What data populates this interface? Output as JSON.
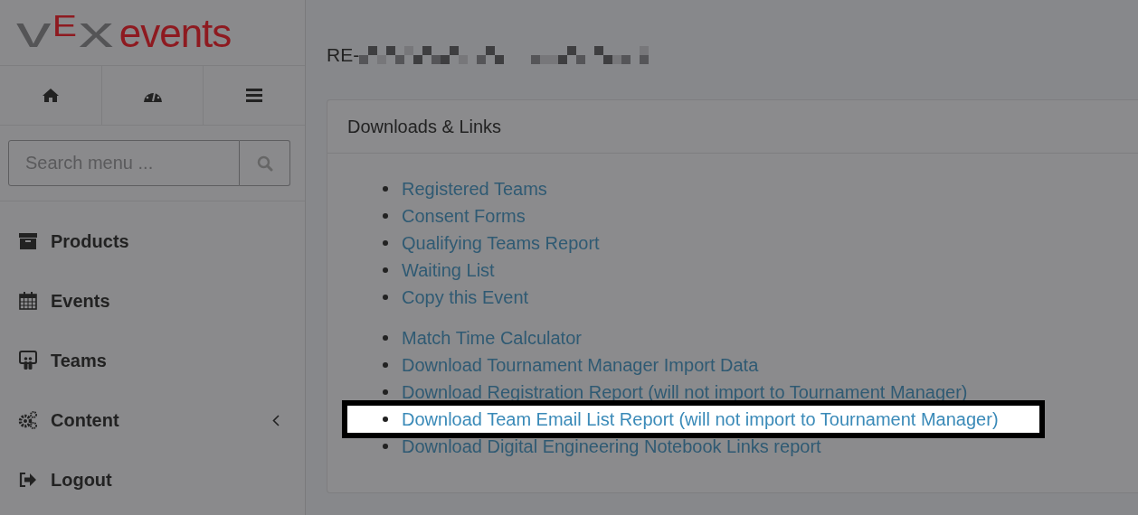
{
  "logo": {
    "mark": [
      {
        "text": "v",
        "kind": "plain"
      },
      {
        "text": "E",
        "kind": "accent"
      },
      {
        "text": "x",
        "kind": "plain"
      }
    ],
    "name": "events"
  },
  "toolbar": [
    {
      "kind": "home"
    },
    {
      "kind": "dashboard"
    },
    {
      "kind": "menu"
    }
  ],
  "search": {
    "placeholder": "Search menu ..."
  },
  "nav": [
    {
      "label": "Products",
      "kind": "box",
      "has_submenu": false
    },
    {
      "label": "Events",
      "kind": "calendar",
      "has_submenu": false
    },
    {
      "label": "Teams",
      "kind": "team",
      "has_submenu": false
    },
    {
      "label": "Content",
      "kind": "gears",
      "has_submenu": true
    },
    {
      "label": "Logout",
      "kind": "logout",
      "has_submenu": false
    }
  ],
  "page_title": "RE-",
  "card": {
    "title": "Downloads & Links",
    "groups": [
      {
        "links": [
          {
            "text": "Registered Teams",
            "highlighted": false
          },
          {
            "text": "Consent Forms",
            "highlighted": false
          },
          {
            "text": "Qualifying Teams Report",
            "highlighted": false
          },
          {
            "text": "Waiting List",
            "highlighted": false
          },
          {
            "text": "Copy this Event",
            "highlighted": false
          }
        ]
      },
      {
        "links": [
          {
            "text": "Match Time Calculator",
            "highlighted": false
          },
          {
            "text": "Download Tournament Manager Import Data",
            "highlighted": false
          },
          {
            "text": "Download Registration Report (will not import to Tournament Manager)",
            "highlighted": false
          },
          {
            "text": "Download Team Email List Report (will not import to Tournament Manager)",
            "highlighted": true
          },
          {
            "text": "Download Digital Engineering Notebook Links report",
            "highlighted": false
          }
        ]
      }
    ]
  }
}
